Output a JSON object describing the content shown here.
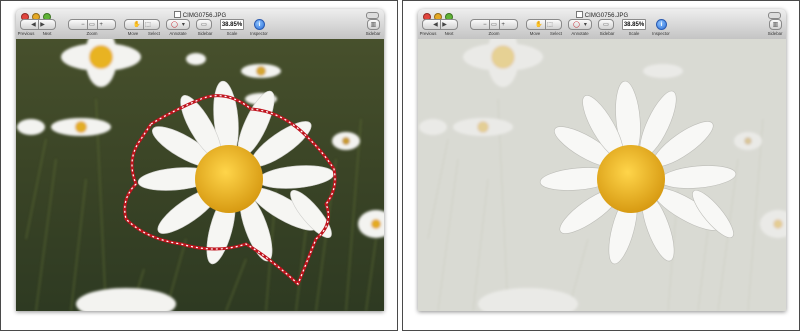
{
  "panels": [
    {
      "id": "left",
      "window": {
        "title": "CIMG0756.JPG",
        "toolbar": {
          "previous": "Previous",
          "next": "Next",
          "zoom": "Zoom",
          "move": "Move",
          "select": "Select",
          "annotate": "Annotate",
          "sidebar_toggle": "Sidebar",
          "scale": "Scale",
          "scale_value": "38.85%",
          "inspector": "Inspector",
          "sidebar": "Sidebar"
        }
      },
      "photo": {
        "state": "selection-outline"
      }
    },
    {
      "id": "right",
      "window": {
        "title": "CIMG0756.JPG",
        "toolbar": {
          "previous": "Previous",
          "next": "Next",
          "zoom": "Zoom",
          "move": "Move",
          "select": "Select",
          "annotate": "Annotate",
          "sidebar_toggle": "Sidebar",
          "scale": "Scale",
          "scale_value": "38.85%",
          "inspector": "Inspector",
          "sidebar": "Sidebar"
        }
      },
      "photo": {
        "state": "background-faded"
      }
    }
  ],
  "colors": {
    "selection_outline": "#c0141e",
    "daisy_center": "#f0b521",
    "grass": "#3f4a26",
    "fade_overlay": "#e4e4e1"
  }
}
